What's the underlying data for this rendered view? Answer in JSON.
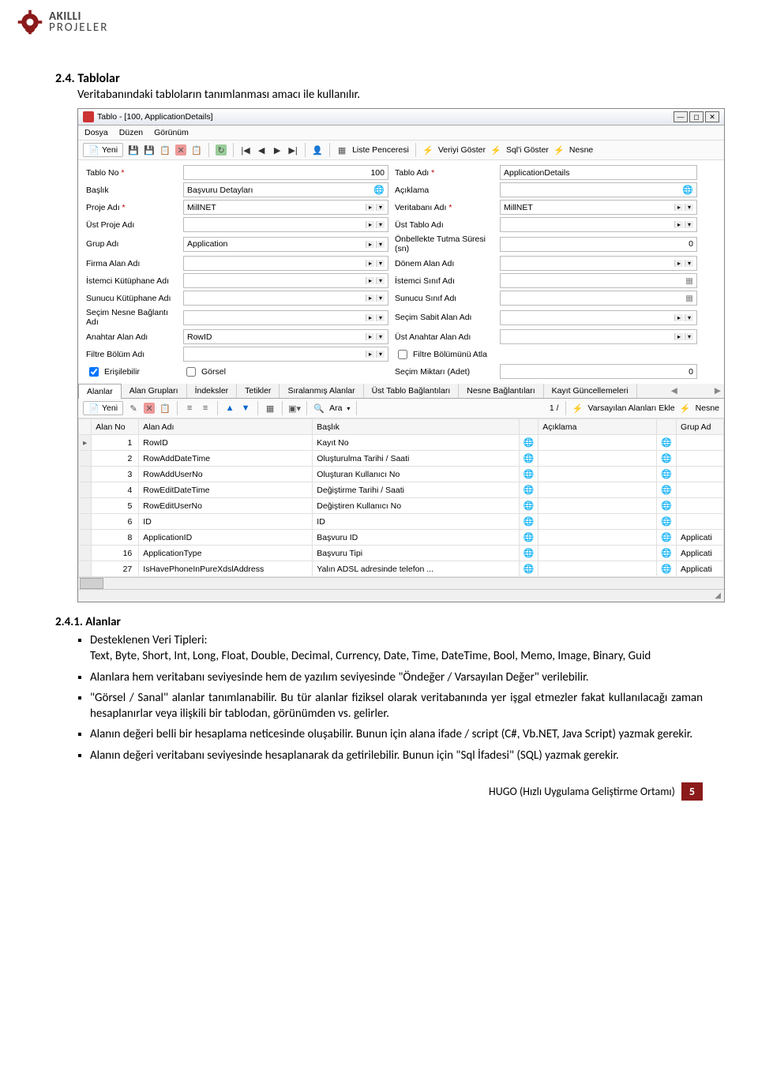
{
  "logo": {
    "top": "AKILLI",
    "bot": "PROJELER"
  },
  "section_24": {
    "heading": "2.4. Tablolar",
    "intro": "Veritabanındaki tabloların tanımlanması amacı ile kullanılır."
  },
  "screenshot": {
    "title": "Tablo - [100, ApplicationDetails]",
    "menu": [
      "Dosya",
      "Düzen",
      "Görünüm"
    ],
    "toolbar": {
      "new": "Yeni",
      "list_window": "Liste Penceresi",
      "veriyi_goster": "Veriyi Göster",
      "sql_goster": "Sql'i Göster",
      "nesne": "Nesne"
    },
    "form": {
      "r1": {
        "l1": "Tablo No",
        "v1": "100",
        "l2": "Tablo Adı",
        "v2": "ApplicationDetails"
      },
      "r2": {
        "l1": "Başlık",
        "v1": "Başvuru Detayları",
        "l2": "Açıklama",
        "v2": ""
      },
      "r3": {
        "l1": "Proje Adı",
        "v1": "MillNET",
        "l2": "Veritabanı Adı",
        "v2": "MillNET"
      },
      "r4": {
        "l1": "Üst Proje Adı",
        "v1": "",
        "l2": "Üst Tablo Adı",
        "v2": ""
      },
      "r5": {
        "l1": "Grup Adı",
        "v1": "Application",
        "l2": "Önbellekte Tutma Süresi (sn)",
        "v2": "0"
      },
      "r6": {
        "l1": "Firma Alan Adı",
        "v1": "",
        "l2": "Dönem Alan Adı",
        "v2": ""
      },
      "r7": {
        "l1": "İstemci Kütüphane Adı",
        "v1": "",
        "l2": "İstemci Sınıf Adı",
        "v2": ""
      },
      "r8": {
        "l1": "Sunucu Kütüphane Adı",
        "v1": "",
        "l2": "Sunucu Sınıf Adı",
        "v2": ""
      },
      "r9": {
        "l1": "Seçim Nesne Bağlantı Adı",
        "v1": "",
        "l2": "Seçim Sabit Alan Adı",
        "v2": ""
      },
      "r10": {
        "l1": "Anahtar Alan Adı",
        "v1": "RowID",
        "l2": "Üst Anahtar Alan Adı",
        "v2": ""
      },
      "r11": {
        "l1": "Filtre Bölüm Adı",
        "v1": "",
        "l2": "Filtre Bölümünü Atla",
        "v2": ""
      },
      "r12": {
        "chk1": "Erişilebilir",
        "chk2": "Görsel",
        "l3": "Seçim Miktarı (Adet)",
        "v3": "0"
      }
    },
    "tabs": [
      "Alanlar",
      "Alan Grupları",
      "İndeksler",
      "Tetikler",
      "Sıralanmış Alanlar",
      "Üst Tablo Bağlantıları",
      "Nesne Bağlantıları",
      "Kayıt Güncellemeleri"
    ],
    "subtool": {
      "new": "Yeni",
      "ara": "Ara",
      "pager": "1 /",
      "varsayilan": "Varsayılan Alanları Ekle",
      "nesne": "Nesne"
    },
    "grid": {
      "headers": [
        "",
        "Alan No",
        "Alan Adı",
        "Başlık",
        "",
        "Açıklama",
        "",
        "Grup Ad"
      ],
      "rows": [
        {
          "no": "1",
          "ad": "RowID",
          "baslik": "Kayıt No",
          "grup": ""
        },
        {
          "no": "2",
          "ad": "RowAddDateTime",
          "baslik": "Oluşturulma Tarihi / Saati",
          "grup": ""
        },
        {
          "no": "3",
          "ad": "RowAddUserNo",
          "baslik": "Oluşturan Kullanıcı No",
          "grup": ""
        },
        {
          "no": "4",
          "ad": "RowEditDateTime",
          "baslik": "Değiştirme Tarihi / Saati",
          "grup": ""
        },
        {
          "no": "5",
          "ad": "RowEditUserNo",
          "baslik": "Değiştiren Kullanıcı No",
          "grup": ""
        },
        {
          "no": "6",
          "ad": "ID",
          "baslik": "ID",
          "grup": ""
        },
        {
          "no": "8",
          "ad": "ApplicationID",
          "baslik": "Başvuru ID",
          "grup": "Applicati"
        },
        {
          "no": "16",
          "ad": "ApplicationType",
          "baslik": "Başvuru Tipi",
          "grup": "Applicati"
        },
        {
          "no": "27",
          "ad": "IsHavePhoneInPureXdslAddress",
          "baslik": "Yalın ADSL adresinde telefon ...",
          "grup": "Applicati"
        }
      ]
    }
  },
  "section_241": {
    "heading": "2.4.1. Alanlar",
    "bullet1_label": "Desteklenen Veri Tipleri:",
    "bullet1_text": "Text, Byte, Short, Int, Long, Float, Double, Decimal, Currency, Date, Time, DateTime, Bool, Memo, Image, Binary, Guid",
    "bullet2": "Alanlara hem veritabanı seviyesinde hem de yazılım seviyesinde \"Öndeğer / Varsayılan Değer\" verilebilir.",
    "bullet3": "\"Görsel / Sanal\" alanlar tanımlanabilir. Bu tür alanlar fiziksel olarak veritabanında yer işgal etmezler fakat kullanılacağı zaman hesaplanırlar veya ilişkili bir tablodan, görünümden vs. gelirler.",
    "bullet4": "Alanın değeri belli bir hesaplama neticesinde oluşabilir. Bunun için alana ifade / script (C#, Vb.NET, Java Script) yazmak gerekir.",
    "bullet5": "Alanın değeri veritabanı seviyesinde hesaplanarak da getirilebilir. Bunun için \"Sql İfadesi\" (SQL) yazmak gerekir."
  },
  "footer": {
    "text": "HUGO (Hızlı Uygulama Geliştirme Ortamı)",
    "page": "5"
  }
}
